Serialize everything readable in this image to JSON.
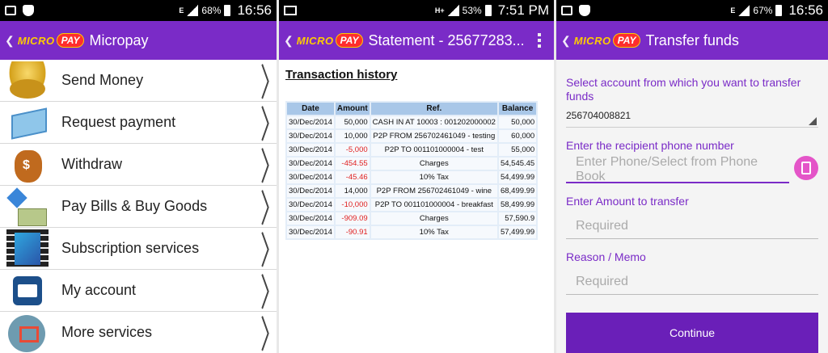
{
  "screen1": {
    "status": {
      "pct": "68%",
      "time": "16:56",
      "net": "E"
    },
    "logo": {
      "micro": "MICRO",
      "pay": "PAY"
    },
    "title": "Micropay",
    "menu": [
      {
        "label": "Send Money",
        "icon": "coins-icon"
      },
      {
        "label": "Request payment",
        "icon": "card-icon"
      },
      {
        "label": "Withdraw",
        "icon": "money-bag-icon"
      },
      {
        "label": "Pay Bills & Buy Goods",
        "icon": "bills-icon"
      },
      {
        "label": "Subscription services",
        "icon": "film-icon"
      },
      {
        "label": "My account",
        "icon": "account-card-icon"
      },
      {
        "label": "More services",
        "icon": "more-services-icon"
      }
    ]
  },
  "screen2": {
    "status": {
      "pct": "53%",
      "time": "7:51 PM",
      "net": "H+"
    },
    "logo": {
      "micro": "MICRO",
      "pay": "PAY"
    },
    "title": "Statement - 25677283...",
    "heading": "Transaction history",
    "table": {
      "headers": [
        "Date",
        "Amount",
        "Ref.",
        "Balance"
      ],
      "rows": [
        {
          "date": "30/Dec/2014",
          "amount": "50,000",
          "ref": "CASH IN AT 10003 : 001202000002",
          "balance": "50,000",
          "neg": false
        },
        {
          "date": "30/Dec/2014",
          "amount": "10,000",
          "ref": "P2P FROM 256702461049 - testing",
          "balance": "60,000",
          "neg": false
        },
        {
          "date": "30/Dec/2014",
          "amount": "-5,000",
          "ref": "P2P TO 001101000004 - test",
          "balance": "55,000",
          "neg": true
        },
        {
          "date": "30/Dec/2014",
          "amount": "-454.55",
          "ref": "Charges",
          "balance": "54,545.45",
          "neg": true
        },
        {
          "date": "30/Dec/2014",
          "amount": "-45.46",
          "ref": "10% Tax",
          "balance": "54,499.99",
          "neg": true
        },
        {
          "date": "30/Dec/2014",
          "amount": "14,000",
          "ref": "P2P FROM 256702461049 - wine",
          "balance": "68,499.99",
          "neg": false
        },
        {
          "date": "30/Dec/2014",
          "amount": "-10,000",
          "ref": "P2P TO 001101000004 - breakfast",
          "balance": "58,499.99",
          "neg": true
        },
        {
          "date": "30/Dec/2014",
          "amount": "-909.09",
          "ref": "Charges",
          "balance": "57,590.9",
          "neg": true
        },
        {
          "date": "30/Dec/2014",
          "amount": "-90.91",
          "ref": "10% Tax",
          "balance": "57,499.99",
          "neg": true
        }
      ]
    }
  },
  "screen3": {
    "status": {
      "pct": "67%",
      "time": "16:56",
      "net": "E"
    },
    "logo": {
      "micro": "MICRO",
      "pay": "PAY"
    },
    "title": "Transfer funds",
    "account_label": "Select account from which you want to transfer funds",
    "account_value": "256704008821",
    "phone_label": "Enter the recipient phone number",
    "phone_placeholder": "Enter Phone/Select from Phone Book",
    "amount_label": "Enter Amount to transfer",
    "amount_placeholder": "Required",
    "memo_label": "Reason / Memo",
    "memo_placeholder": "Required",
    "continue_label": "Continue"
  },
  "colors": {
    "brand": "#7a2bc7",
    "negative": "#e02020"
  }
}
